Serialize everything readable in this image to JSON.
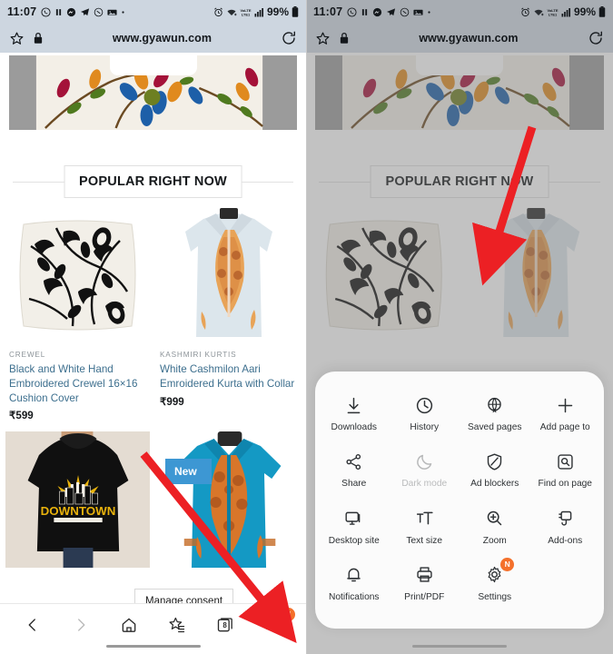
{
  "statusbar": {
    "time": "11:07",
    "notification_icons": [
      "whatsapp-icon",
      "pause-icon",
      "messenger-icon",
      "telegram-icon",
      "clock-outline-icon",
      "gallery-icon",
      "dot-icon"
    ],
    "system_icons": [
      "alarm-icon",
      "wifi-icon",
      "volte-icon",
      "signal-icon"
    ],
    "battery_percent": "99%",
    "volte_label": "VoLTE"
  },
  "urlbar": {
    "url": "www.gyawun.com",
    "bookmark_icon": "star-icon",
    "secure_icon": "lock-icon",
    "reload_icon": "reload-icon"
  },
  "page": {
    "section_heading": "POPULAR RIGHT NOW",
    "new_badge": "New",
    "consent_tooltip": "Manage consent",
    "products": [
      {
        "category": "CREWEL",
        "name": "Black and White Hand Embroidered Crewel 16×16 Cushion Cover",
        "price": "₹599"
      },
      {
        "category": "KASHMIRI KURTIS",
        "name": "White Cashmilon Aari Emroidered Kurta with Collar",
        "price": "₹999"
      }
    ],
    "hoodie_text": "DOWNTOWN"
  },
  "bottomnav": {
    "items": [
      {
        "name": "back-button",
        "icon": "chevron-left-icon",
        "disabled": false
      },
      {
        "name": "forward-button",
        "icon": "chevron-right-icon",
        "disabled": true
      },
      {
        "name": "home-button",
        "icon": "home-icon",
        "disabled": false
      },
      {
        "name": "bookmarks-button",
        "icon": "star-list-icon",
        "disabled": false
      },
      {
        "name": "tabs-button",
        "icon": "tabs-icon",
        "disabled": false
      },
      {
        "name": "menu-button",
        "icon": "hamburger-icon",
        "disabled": false
      }
    ],
    "tab_count": "8",
    "menu_badge": "N"
  },
  "menu": {
    "rows": [
      [
        {
          "label": "Downloads",
          "icon": "download-icon",
          "disabled": false,
          "badge": ""
        },
        {
          "label": "History",
          "icon": "history-clock-icon",
          "disabled": false,
          "badge": ""
        },
        {
          "label": "Saved pages",
          "icon": "globe-save-icon",
          "disabled": false,
          "badge": ""
        },
        {
          "label": "Add page to",
          "icon": "plus-icon",
          "disabled": false,
          "badge": ""
        }
      ],
      [
        {
          "label": "Share",
          "icon": "share-icon",
          "disabled": false,
          "badge": ""
        },
        {
          "label": "Dark mode",
          "icon": "moon-icon",
          "disabled": true,
          "badge": ""
        },
        {
          "label": "Ad blockers",
          "icon": "shield-block-icon",
          "disabled": false,
          "badge": ""
        },
        {
          "label": "Find on page",
          "icon": "find-on-page-icon",
          "disabled": false,
          "badge": ""
        }
      ],
      [
        {
          "label": "Desktop site",
          "icon": "desktop-monitor-icon",
          "disabled": false,
          "badge": ""
        },
        {
          "label": "Text size",
          "icon": "text-size-icon",
          "disabled": false,
          "badge": ""
        },
        {
          "label": "Zoom",
          "icon": "zoom-in-icon",
          "disabled": false,
          "badge": ""
        },
        {
          "label": "Add-ons",
          "icon": "addons-plug-icon",
          "disabled": false,
          "badge": ""
        }
      ],
      [
        {
          "label": "Notifications",
          "icon": "bell-icon",
          "disabled": false,
          "badge": ""
        },
        {
          "label": "Print/PDF",
          "icon": "printer-icon",
          "disabled": false,
          "badge": ""
        },
        {
          "label": "Settings",
          "icon": "gear-icon",
          "disabled": false,
          "badge": "N"
        },
        {
          "label": "",
          "icon": "",
          "disabled": false,
          "badge": ""
        }
      ]
    ]
  },
  "annotations": {
    "left_arrow_target": "menu-button",
    "right_arrow_target": "Settings",
    "arrow_color": "#ec2024"
  }
}
